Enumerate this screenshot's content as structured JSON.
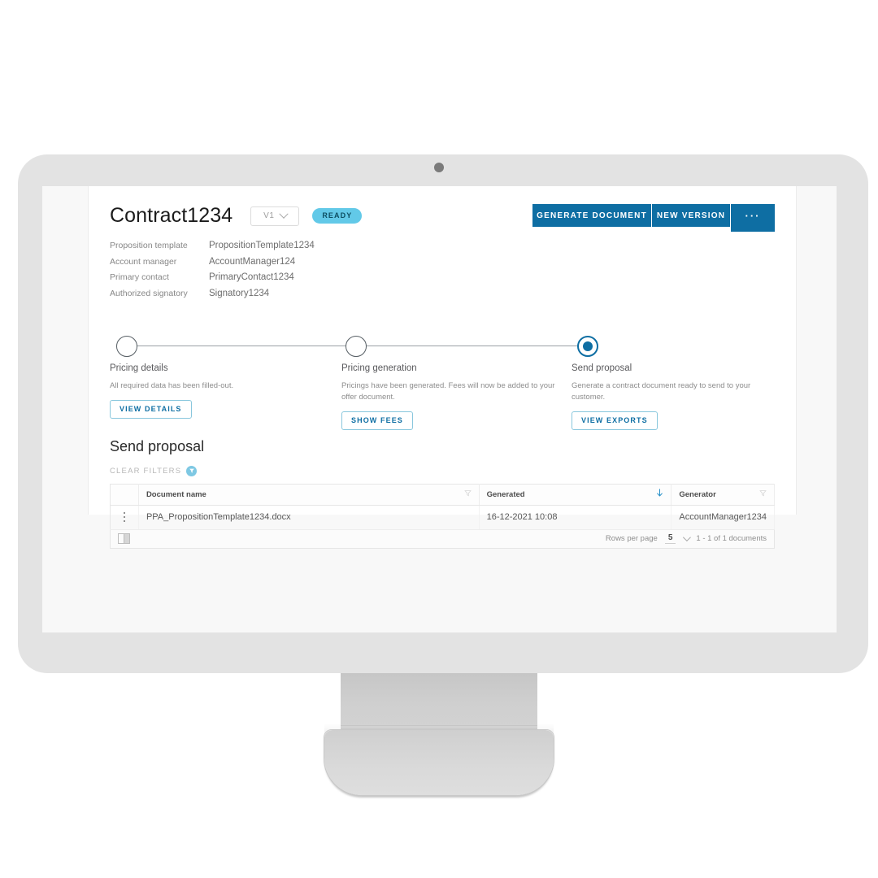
{
  "header": {
    "title": "Contract1234",
    "version": "V1",
    "status_badge": "READY",
    "meta": [
      {
        "label": "Proposition template",
        "value": "PropositionTemplate1234"
      },
      {
        "label": "Account manager",
        "value": "AccountManager124"
      },
      {
        "label": "Primary contact",
        "value": "PrimaryContact1234"
      },
      {
        "label": "Authorized signatory",
        "value": "Signatory1234"
      }
    ],
    "actions": [
      {
        "label": "GENERATE DOCUMENT"
      },
      {
        "label": "NEW VERSION"
      },
      {
        "label": "···"
      }
    ]
  },
  "stepper": {
    "steps": [
      {
        "title": "Pricing details",
        "description": "All required data has been filled-out.",
        "button": "VIEW DETAILS",
        "state": "complete"
      },
      {
        "title": "Pricing generation",
        "description": "Pricings have been generated. Fees will now be added to your offer document.",
        "button": "SHOW FEES",
        "state": "complete"
      },
      {
        "title": "Send proposal",
        "description": "Generate a contract document ready to send to your customer.",
        "button": "VIEW EXPORTS",
        "state": "active"
      }
    ]
  },
  "section": {
    "title": "Send proposal",
    "clear_filters": "CLEAR FILTERS"
  },
  "table": {
    "columns": [
      {
        "label": "Document name",
        "icon": "filter-icon"
      },
      {
        "label": "Generated",
        "icon": "sort-desc-icon"
      },
      {
        "label": "Generator",
        "icon": "filter-icon"
      }
    ],
    "rows": [
      {
        "document_name": "PPA_PropositionTemplate1234.docx",
        "generated": "16-12-2021 10:08",
        "generator": "AccountManager1234"
      }
    ],
    "footer": {
      "rows_per_page_label": "Rows per page",
      "rows_per_page_value": "5",
      "range": "1 - 1 of 1 documents"
    }
  },
  "colors": {
    "primary": "#0e6ea3",
    "badge": "#62c9e8",
    "outline_button_border": "#89c7dd"
  }
}
